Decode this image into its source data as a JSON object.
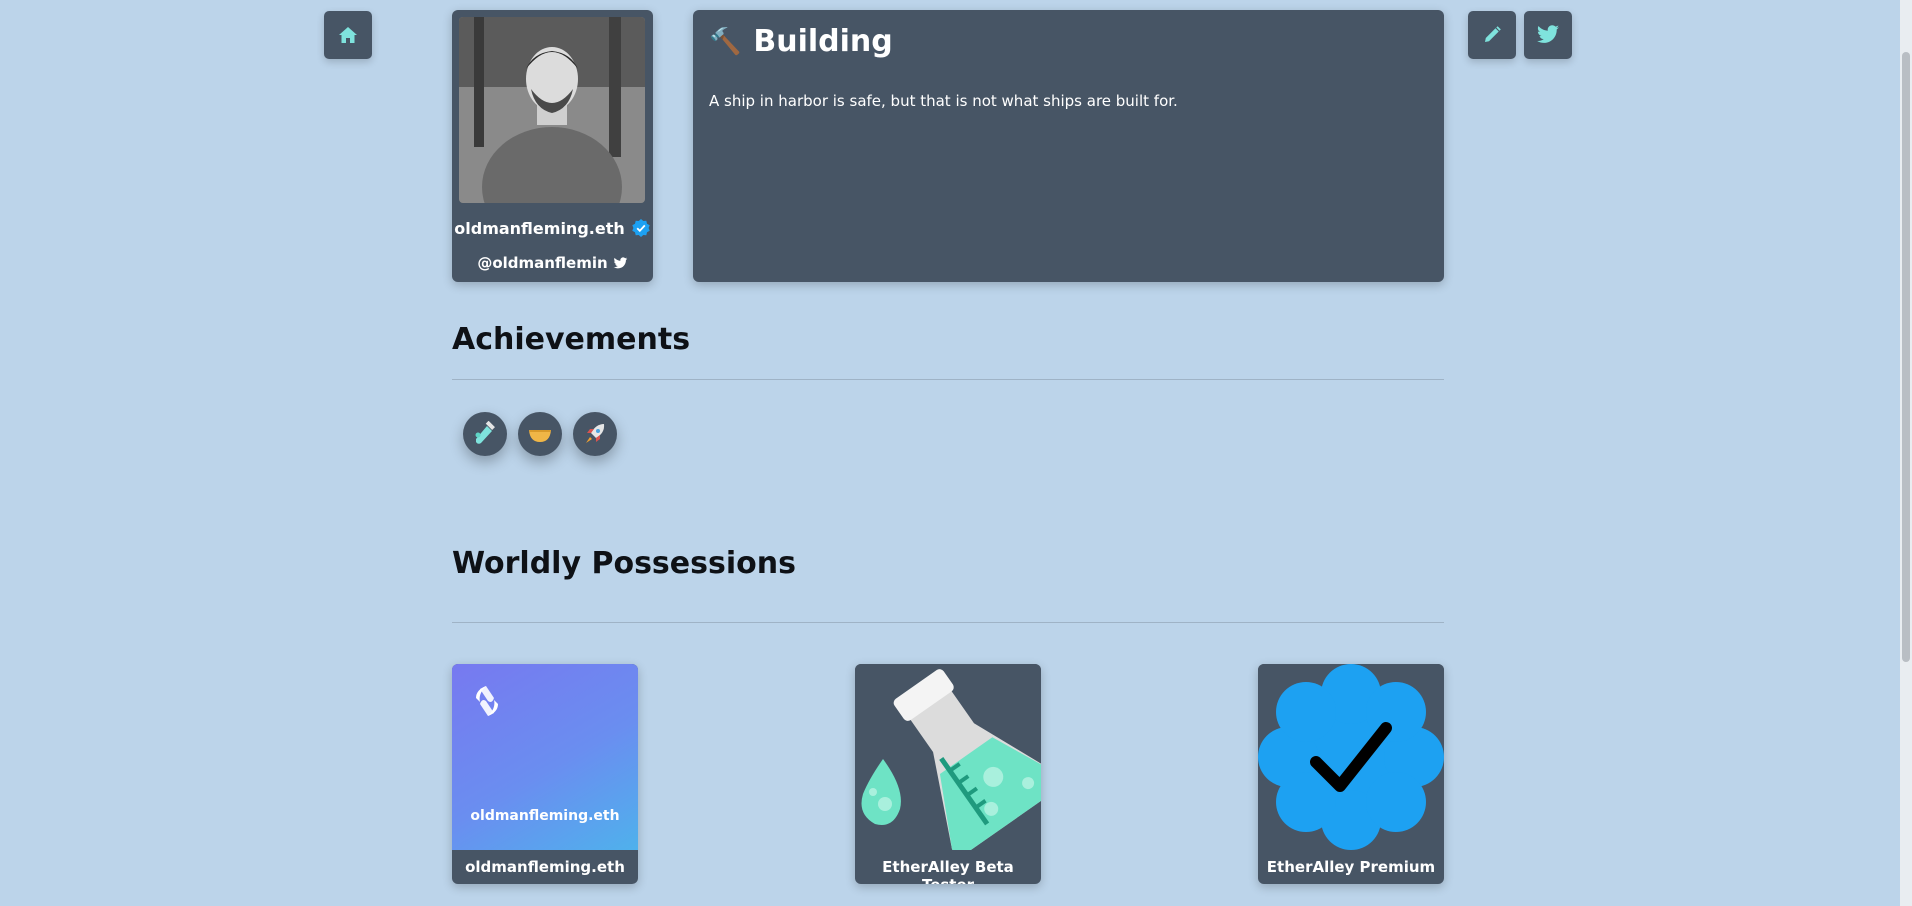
{
  "nav": {
    "home_icon": "home-icon",
    "edit_icon": "pencil-icon",
    "twitter_icon": "twitter-icon"
  },
  "profile": {
    "name": "oldmanfleming.eth",
    "handle": "@oldmanflemin",
    "verified_icon": "verified-badge-icon"
  },
  "status": {
    "emoji": "🔨",
    "title": "Building",
    "description": "A ship in harbor is safe, but that is not what ships are built for."
  },
  "achievements": {
    "heading": "Achievements",
    "badges": [
      {
        "icon": "test-tube-icon"
      },
      {
        "icon": "bowl-icon"
      },
      {
        "icon": "rocket-icon"
      }
    ]
  },
  "possessions": {
    "heading": "Worldly Possessions",
    "items": [
      {
        "label": "oldmanfleming.eth",
        "image_text": "oldmanfleming.eth",
        "image": "ens-logo"
      },
      {
        "label": "EtherAlley Beta Tester",
        "image": "flask-icon"
      },
      {
        "label": "EtherAlley Premium",
        "image": "verified-check-icon"
      }
    ]
  },
  "colors": {
    "background": "#bcd4ea",
    "card": "#475565",
    "accent": "#1da1f2",
    "icon": "#7fe3dd"
  }
}
